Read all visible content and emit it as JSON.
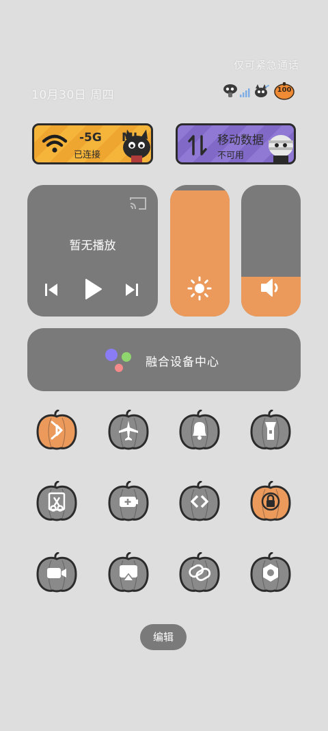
{
  "header": {
    "emergency_text": "仅可紧急通话",
    "date_text": "10月30日 周四",
    "battery_level": "100"
  },
  "tiles": {
    "wifi": {
      "title": "-5G",
      "title_extra": "MI",
      "subtitle": "已连接",
      "icon": "wifi-icon"
    },
    "mobile_data": {
      "title": "移动数据",
      "subtitle": "不可用",
      "icon": "data-arrows-icon"
    }
  },
  "media": {
    "title": "暂无播放",
    "controls": [
      "previous-icon",
      "play-icon",
      "next-icon"
    ],
    "cast_icon": "cast-icon"
  },
  "sliders": {
    "brightness": {
      "level": 0.96,
      "icon": "sun-icon"
    },
    "volume": {
      "level": 0.3,
      "icon": "speaker-icon"
    }
  },
  "fusion": {
    "label": "融合设备中心",
    "icon": "assistant-dots-icon"
  },
  "toggles": [
    {
      "name": "bluetooth",
      "active": true
    },
    {
      "name": "airplane",
      "active": false
    },
    {
      "name": "bell",
      "active": false
    },
    {
      "name": "flashlight",
      "active": false
    },
    {
      "name": "screenshot-scissors",
      "active": false
    },
    {
      "name": "battery-saver",
      "active": false
    },
    {
      "name": "link-arrows",
      "active": false
    },
    {
      "name": "rotation-lock",
      "active": true
    },
    {
      "name": "video-camera",
      "active": false
    },
    {
      "name": "screen-cast",
      "active": false
    },
    {
      "name": "link-rings",
      "active": false
    },
    {
      "name": "settings-hex",
      "active": false
    }
  ],
  "colors": {
    "card": "#7a7a7a",
    "accent_orange": "#eb9a5b",
    "wifi_tile": "#f5b53b",
    "mobile_tile": "#8f79d4"
  },
  "edit_label": "编辑"
}
